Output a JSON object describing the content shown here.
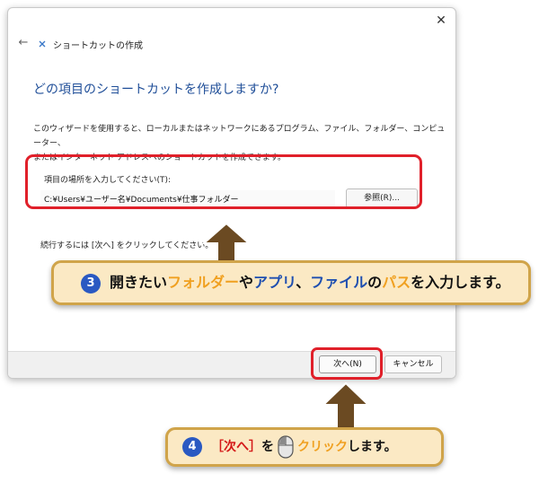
{
  "dialog": {
    "window_title": "ショートカットの作成",
    "heading": "どの項目のショートカットを作成しますか?",
    "description_line1": "このウィザードを使用すると、ローカルまたはネットワークにあるプログラム、ファイル、フォルダー、コンピューター、",
    "description_line2": "またはインターネット アドレスへのショートカットを作成できます。",
    "location_label": "項目の場所を入力してください(T):",
    "location_value": "C:¥Users¥ユーザー名¥Documents¥仕事フォルダー",
    "browse_label": "参照(R)...",
    "continue_text": "続行するには [次へ] をクリックしてください。",
    "next_label": "次へ(N)",
    "cancel_label": "キャンセル",
    "close_symbol": "✕",
    "back_symbol": "←"
  },
  "callout1": {
    "number": "3",
    "part1": "開きたい",
    "part2": "フォルダー",
    "part3": "や",
    "part4": "アプリ",
    "part5": "、",
    "part6": "ファイル",
    "part7": "の",
    "part8": "パス",
    "part9": "を入力します。"
  },
  "callout2": {
    "number": "4",
    "part1": "［次へ］",
    "part2": "を",
    "part3": "クリック",
    "part4": "します。"
  },
  "icons": {
    "close": "close-icon",
    "back": "back-arrow-icon",
    "app": "shortcut-icon",
    "mouse": "mouse-icon",
    "arrow": "up-arrow-icon"
  },
  "colors": {
    "highlight": "#e0202a",
    "callout_bg": "#fbe9c4",
    "callout_border": "#d0a44a",
    "arrow": "#6b4a22",
    "heading": "#1f4e98",
    "orange_text": "#f0a020",
    "blue_text": "#1f4fb0",
    "red_text": "#d41818",
    "number_badge": "#2a59c2"
  }
}
